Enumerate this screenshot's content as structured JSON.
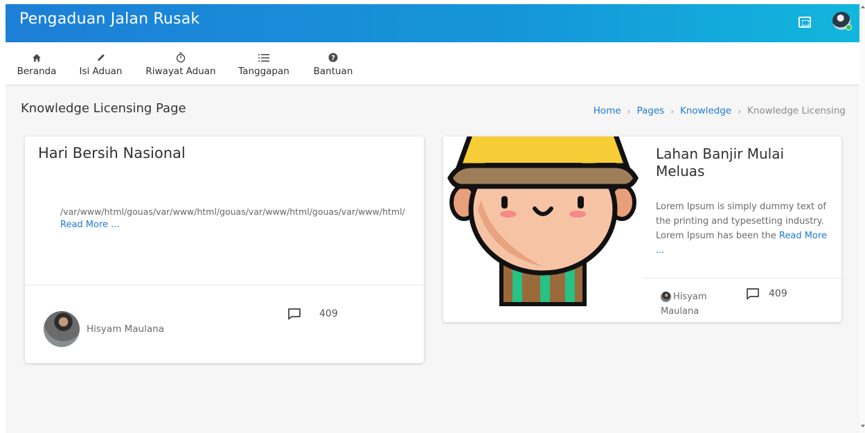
{
  "header": {
    "brand": "Pengaduan Jalan Rusak",
    "icons": {
      "fullscreen": "fullscreen-icon",
      "avatar": "user-avatar"
    },
    "colors": {
      "gradient_start": "#1d7fd6",
      "gradient_end": "#12b6dd",
      "online": "#35c24a"
    }
  },
  "nav": {
    "items": [
      {
        "label": "Beranda",
        "icon": "home-icon"
      },
      {
        "label": "Isi Aduan",
        "icon": "pencil-icon"
      },
      {
        "label": "Riwayat Aduan",
        "icon": "stopwatch-icon"
      },
      {
        "label": "Tanggapan",
        "icon": "list-icon"
      },
      {
        "label": "Bantuan",
        "icon": "help-circle-icon"
      }
    ]
  },
  "page": {
    "title": "Knowledge Licensing Page",
    "breadcrumb": [
      "Home",
      "Pages",
      "Knowledge",
      "Knowledge Licensing"
    ]
  },
  "cards": [
    {
      "title": "Hari Bersih Nasional",
      "text": "/var/www/html/gouas/var/www/html/gouas/var/www/html/gouas/var/www/html/",
      "read_more": "Read More ...",
      "author": "Hisyam Maulana",
      "comments": "409"
    },
    {
      "title": "Lahan Banjir Mulai Meluas",
      "text": "Lorem Ipsum is simply dummy text of the printing and typesetting industry. Lorem Ipsum has been the ",
      "read_more": "Read More ...",
      "author": "Hisyam Maulana",
      "comments": "409"
    }
  ],
  "accent_color": "#1f79d3"
}
